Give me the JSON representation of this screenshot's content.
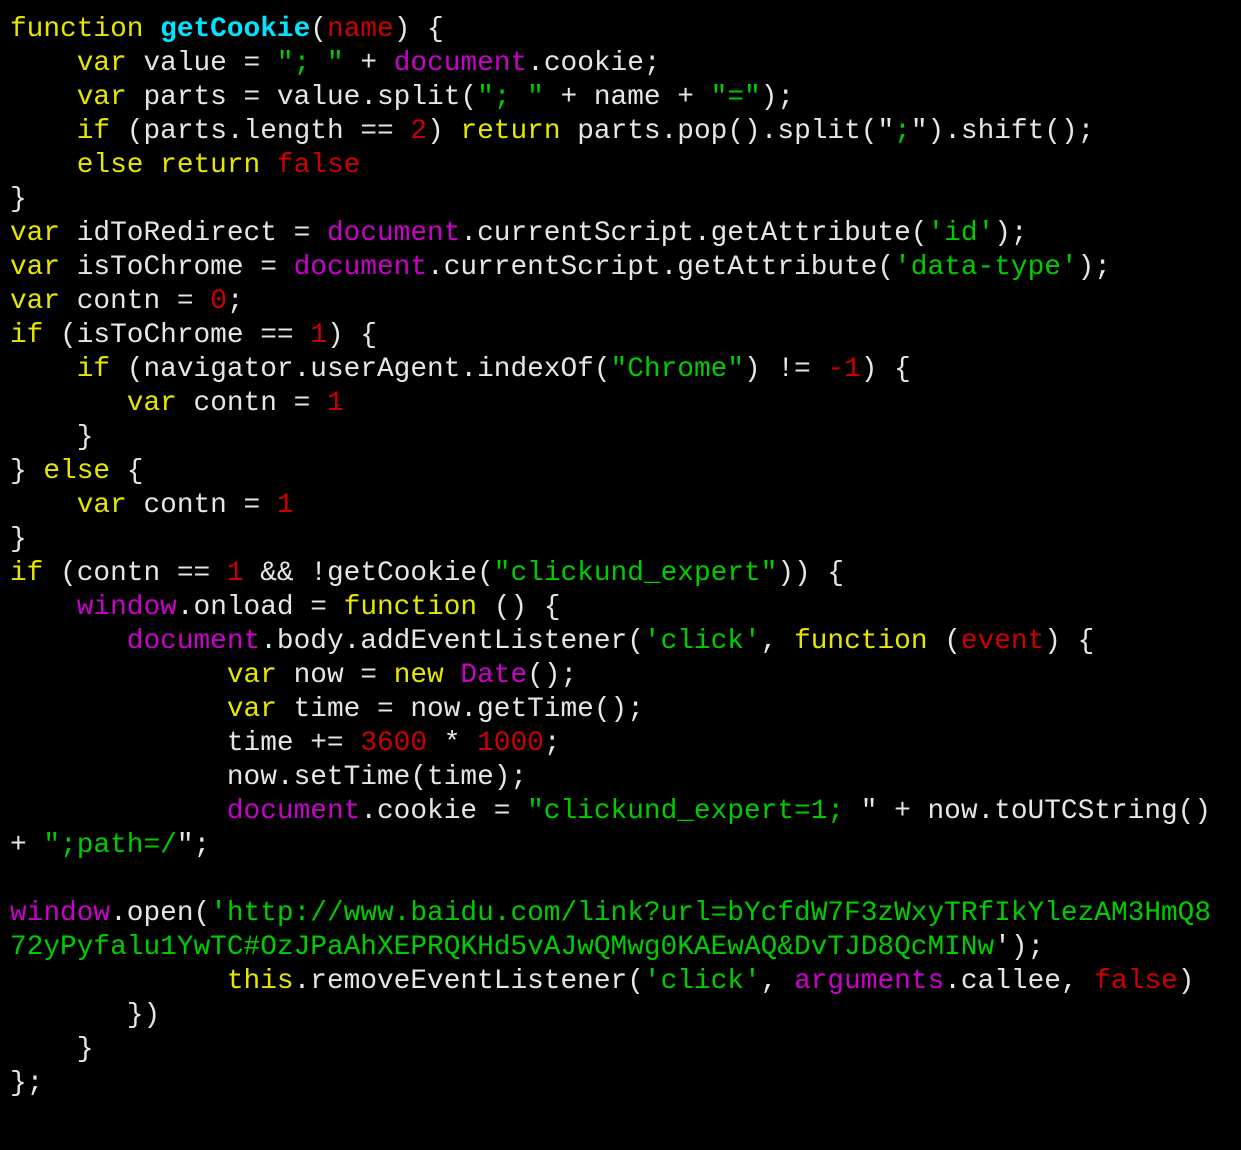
{
  "editor": {
    "language": "javascript",
    "colors": {
      "keyword": "#e6e600",
      "function_name": "#00e5ff",
      "builtin_object": "#cc00cc",
      "string": "#00cc00",
      "number_param": "#cc0000",
      "plain": "#e6e6e6",
      "background": "#000000"
    },
    "lines": [
      [
        [
          "kw",
          "function"
        ],
        [
          "pl",
          " "
        ],
        [
          "fn",
          "getCookie"
        ],
        [
          "pl",
          "("
        ],
        [
          "num",
          "name"
        ],
        [
          "pl",
          ") {"
        ]
      ],
      [
        [
          "pl",
          "    "
        ],
        [
          "kw",
          "var"
        ],
        [
          "pl",
          " value = "
        ],
        [
          "str",
          "\"; \""
        ],
        [
          "pl",
          " + "
        ],
        [
          "obj",
          "document"
        ],
        [
          "pl",
          ".cookie;"
        ]
      ],
      [
        [
          "pl",
          "    "
        ],
        [
          "kw",
          "var"
        ],
        [
          "pl",
          " parts = value.split("
        ],
        [
          "str",
          "\"; \""
        ],
        [
          "pl",
          " + name + "
        ],
        [
          "str",
          "\"=\""
        ],
        [
          "pl",
          ");"
        ]
      ],
      [
        [
          "pl",
          "    "
        ],
        [
          "kw",
          "if"
        ],
        [
          "pl",
          " (parts.length == "
        ],
        [
          "num",
          "2"
        ],
        [
          "pl",
          ") "
        ],
        [
          "kw",
          "return"
        ],
        [
          "pl",
          " parts.pop().split(\""
        ],
        [
          "str",
          ";"
        ],
        [
          "pl",
          "\").shift();"
        ]
      ],
      [
        [
          "pl",
          "    "
        ],
        [
          "kw",
          "else return"
        ],
        [
          "pl",
          " "
        ],
        [
          "num",
          "false"
        ]
      ],
      [
        [
          "pl",
          "}"
        ]
      ],
      [
        [
          "kw",
          "var"
        ],
        [
          "pl",
          " idToRedirect = "
        ],
        [
          "obj",
          "document"
        ],
        [
          "pl",
          ".currentScript.getAttribute("
        ],
        [
          "str",
          "'id'"
        ],
        [
          "pl",
          ");"
        ]
      ],
      [
        [
          "kw",
          "var"
        ],
        [
          "pl",
          " isToChrome = "
        ],
        [
          "obj",
          "document"
        ],
        [
          "pl",
          ".currentScript.getAttribute("
        ],
        [
          "str",
          "'data-type'"
        ],
        [
          "pl",
          ");"
        ]
      ],
      [
        [
          "kw",
          "var"
        ],
        [
          "pl",
          " contn = "
        ],
        [
          "num",
          "0"
        ],
        [
          "pl",
          ";"
        ]
      ],
      [
        [
          "kw",
          "if"
        ],
        [
          "pl",
          " (isToChrome == "
        ],
        [
          "num",
          "1"
        ],
        [
          "pl",
          ") {"
        ]
      ],
      [
        [
          "pl",
          "    "
        ],
        [
          "kw",
          "if"
        ],
        [
          "pl",
          " (navigator.userAgent.indexOf("
        ],
        [
          "str",
          "\"Chrome\""
        ],
        [
          "pl",
          ") != "
        ],
        [
          "num",
          "-1"
        ],
        [
          "pl",
          ") {"
        ]
      ],
      [
        [
          "pl",
          "       "
        ],
        [
          "kw",
          "var"
        ],
        [
          "pl",
          " contn = "
        ],
        [
          "num",
          "1"
        ]
      ],
      [
        [
          "pl",
          "    }"
        ]
      ],
      [
        [
          "pl",
          "} "
        ],
        [
          "kw",
          "else"
        ],
        [
          "pl",
          " {"
        ]
      ],
      [
        [
          "pl",
          "    "
        ],
        [
          "kw",
          "var"
        ],
        [
          "pl",
          " contn = "
        ],
        [
          "num",
          "1"
        ]
      ],
      [
        [
          "pl",
          "}"
        ]
      ],
      [
        [
          "kw",
          "if"
        ],
        [
          "pl",
          " (contn == "
        ],
        [
          "num",
          "1"
        ],
        [
          "pl",
          " && !getCookie("
        ],
        [
          "str",
          "\"clickund_expert\""
        ],
        [
          "pl",
          ")) {"
        ]
      ],
      [
        [
          "pl",
          "    "
        ],
        [
          "obj",
          "window"
        ],
        [
          "pl",
          ".onload = "
        ],
        [
          "kw",
          "function"
        ],
        [
          "pl",
          " () {"
        ]
      ],
      [
        [
          "pl",
          "       "
        ],
        [
          "obj",
          "document"
        ],
        [
          "pl",
          ".body.addEventListener("
        ],
        [
          "str",
          "'click'"
        ],
        [
          "pl",
          ", "
        ],
        [
          "kw",
          "function"
        ],
        [
          "pl",
          " ("
        ],
        [
          "num",
          "event"
        ],
        [
          "pl",
          ") {"
        ]
      ],
      [
        [
          "pl",
          "             "
        ],
        [
          "kw",
          "var"
        ],
        [
          "pl",
          " now = "
        ],
        [
          "kw",
          "new"
        ],
        [
          "pl",
          " "
        ],
        [
          "obj",
          "Date"
        ],
        [
          "pl",
          "();"
        ]
      ],
      [
        [
          "pl",
          "             "
        ],
        [
          "kw",
          "var"
        ],
        [
          "pl",
          " time = now.getTime();"
        ]
      ],
      [
        [
          "pl",
          "             time += "
        ],
        [
          "num",
          "3600"
        ],
        [
          "pl",
          " * "
        ],
        [
          "num",
          "1000"
        ],
        [
          "pl",
          ";"
        ]
      ],
      [
        [
          "pl",
          "             now.setTime(time);"
        ]
      ],
      [
        [
          "pl",
          "             "
        ],
        [
          "obj",
          "document"
        ],
        [
          "pl",
          ".cookie = "
        ],
        [
          "str",
          "\"clickund_expert=1; "
        ],
        [
          "pl",
          "\" + now.toUTCString()"
        ]
      ],
      [
        [
          "pl",
          "+ "
        ],
        [
          "str",
          "\";path=/"
        ],
        [
          "pl",
          "\";"
        ]
      ],
      [
        [
          "pl",
          ""
        ]
      ],
      [
        [
          "obj",
          "window"
        ],
        [
          "pl",
          ".open("
        ],
        [
          "str",
          "'http://www.baidu.com/link?url=bYcfdW7F3zWxyTRfIkYlezAM3HmQ8"
        ]
      ],
      [
        [
          "str",
          "72yPyfalu1YwTC#OzJPaAhXEPRQKHd5vAJwQMwg0KAEwAQ&DvTJD8QcMINw"
        ],
        [
          "pl",
          "');"
        ]
      ],
      [
        [
          "pl",
          "             "
        ],
        [
          "kw",
          "this"
        ],
        [
          "pl",
          ".removeEventListener("
        ],
        [
          "str",
          "'click'"
        ],
        [
          "pl",
          ", "
        ],
        [
          "obj",
          "arguments"
        ],
        [
          "pl",
          ".callee, "
        ],
        [
          "num",
          "false"
        ],
        [
          "pl",
          ")"
        ]
      ],
      [
        [
          "pl",
          "       })"
        ]
      ],
      [
        [
          "pl",
          "    }"
        ]
      ],
      [
        [
          "pl",
          "};"
        ]
      ]
    ]
  }
}
